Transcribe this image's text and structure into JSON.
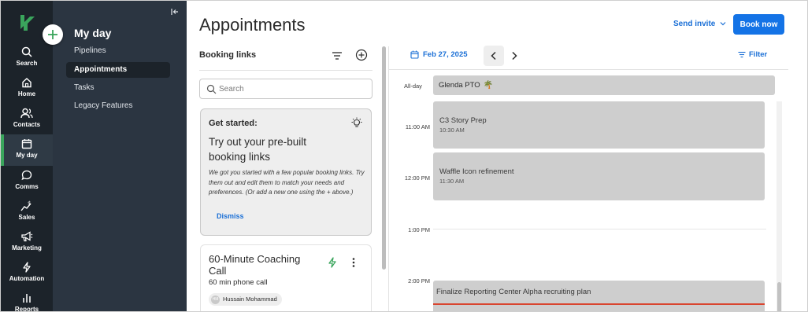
{
  "rail": {
    "items": [
      {
        "label": "Search",
        "icon": "search-icon"
      },
      {
        "label": "Home",
        "icon": "home-icon"
      },
      {
        "label": "Contacts",
        "icon": "contacts-icon"
      },
      {
        "label": "My day",
        "icon": "calendar-icon",
        "active": true
      },
      {
        "label": "Comms",
        "icon": "chat-icon"
      },
      {
        "label": "Sales",
        "icon": "sales-icon"
      },
      {
        "label": "Marketing",
        "icon": "megaphone-icon"
      },
      {
        "label": "Automation",
        "icon": "bolt-icon"
      },
      {
        "label": "Reports",
        "icon": "bar-chart-icon"
      }
    ]
  },
  "subnav": {
    "title": "My day",
    "items": [
      {
        "label": "Pipelines"
      },
      {
        "label": "Appointments",
        "active": true
      },
      {
        "label": "Tasks"
      },
      {
        "label": "Legacy Features"
      }
    ]
  },
  "header": {
    "title": "Appointments",
    "send_invite": "Send invite",
    "book_now": "Book now"
  },
  "booking": {
    "title": "Booking links",
    "search_placeholder": "Search",
    "get_started": {
      "label": "Get started:",
      "heading": "Try out your pre-built booking links",
      "body": "We got you started with a few popular booking links. Try them out and edit them to match your needs and preferences. (Or add a new one using the + above.)",
      "dismiss": "Dismiss"
    },
    "links": [
      {
        "title": "60-Minute Coaching Call",
        "subtitle": "60 min phone call",
        "owner": "Hussain Mohammad",
        "owner_initials": "HM"
      }
    ]
  },
  "calendar": {
    "date": "Feb 27, 2025",
    "filter": "Filter",
    "allday_label": "All-day",
    "allday_event": "Glenda PTO",
    "allday_emoji": "🌴",
    "time_labels": [
      "11:00 AM",
      "12:00 PM",
      "1:00 PM",
      "2:00 PM"
    ],
    "events": [
      {
        "title": "C3 Story Prep",
        "time": "10:30 AM"
      },
      {
        "title": "Waffle Icon refinement",
        "time": "11:30 AM"
      },
      {
        "title": "Finalize Reporting Center Alpha recruiting plan"
      }
    ]
  },
  "colors": {
    "rail_bg": "#1c232a",
    "subnav_bg": "#2b3541",
    "accent_blue": "#1473e6",
    "brand_green": "#3aa55c",
    "now_line": "#d9452f"
  }
}
